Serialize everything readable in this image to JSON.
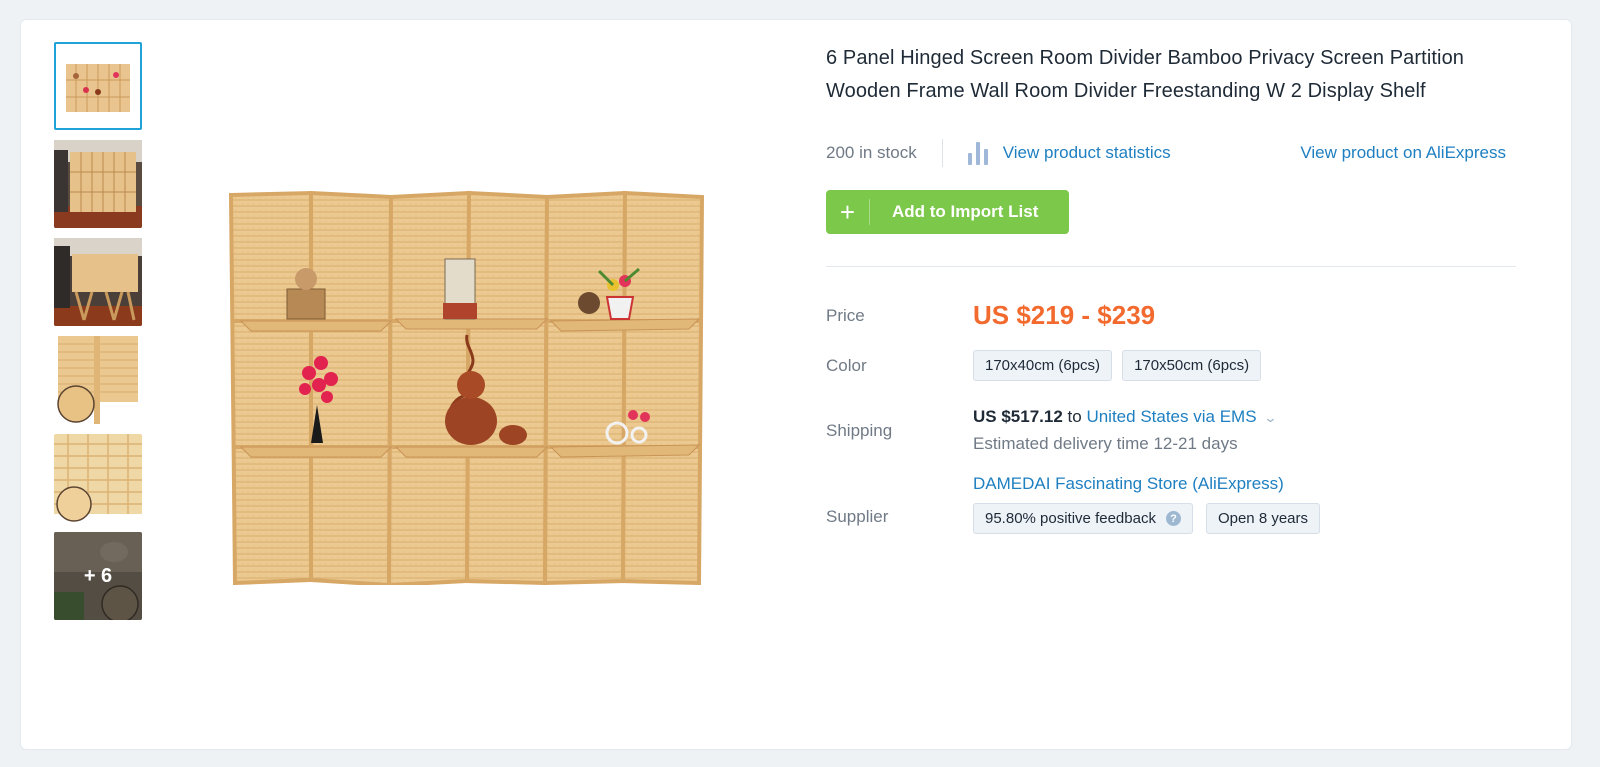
{
  "product": {
    "title": "6 Panel Hinged Screen Room Divider Bamboo Privacy Screen Partition Wooden Frame Wall Room Divider Freestanding W 2 Display Shelf",
    "stock": "200 in stock",
    "stats_link": "View product statistics",
    "ali_link": "View product on AliExpress",
    "import_button": "Add to Import List",
    "import_icon": "+"
  },
  "thumbnails": {
    "more_label": "+ 6",
    "items": [
      "thumb-1",
      "thumb-2",
      "thumb-3",
      "thumb-4",
      "thumb-5",
      "thumb-6"
    ]
  },
  "details": {
    "price_label": "Price",
    "price": "US $219 - $239",
    "color_label": "Color",
    "colors": [
      "170x40cm (6pcs)",
      "170x50cm (6pcs)"
    ],
    "shipping_label": "Shipping",
    "shipping_amount": "US $517.12",
    "shipping_to": "to",
    "shipping_dest": "United States via EMS",
    "delivery": "Estimated delivery time 12-21 days",
    "supplier_label": "Supplier",
    "supplier_name": "DAMEDAI Fascinating Store (AliExpress)",
    "feedback": "95.80% positive feedback",
    "open_years": "Open 8 years"
  },
  "colors": {
    "accent_blue": "#1e7fc1",
    "price_orange": "#f26a2e",
    "button_green": "#7cc84b",
    "thumb_active": "#1fa2d8"
  },
  "icons": {
    "stats": "bar-chart-icon",
    "dropdown": "chevron-down-icon",
    "help": "help-icon"
  }
}
